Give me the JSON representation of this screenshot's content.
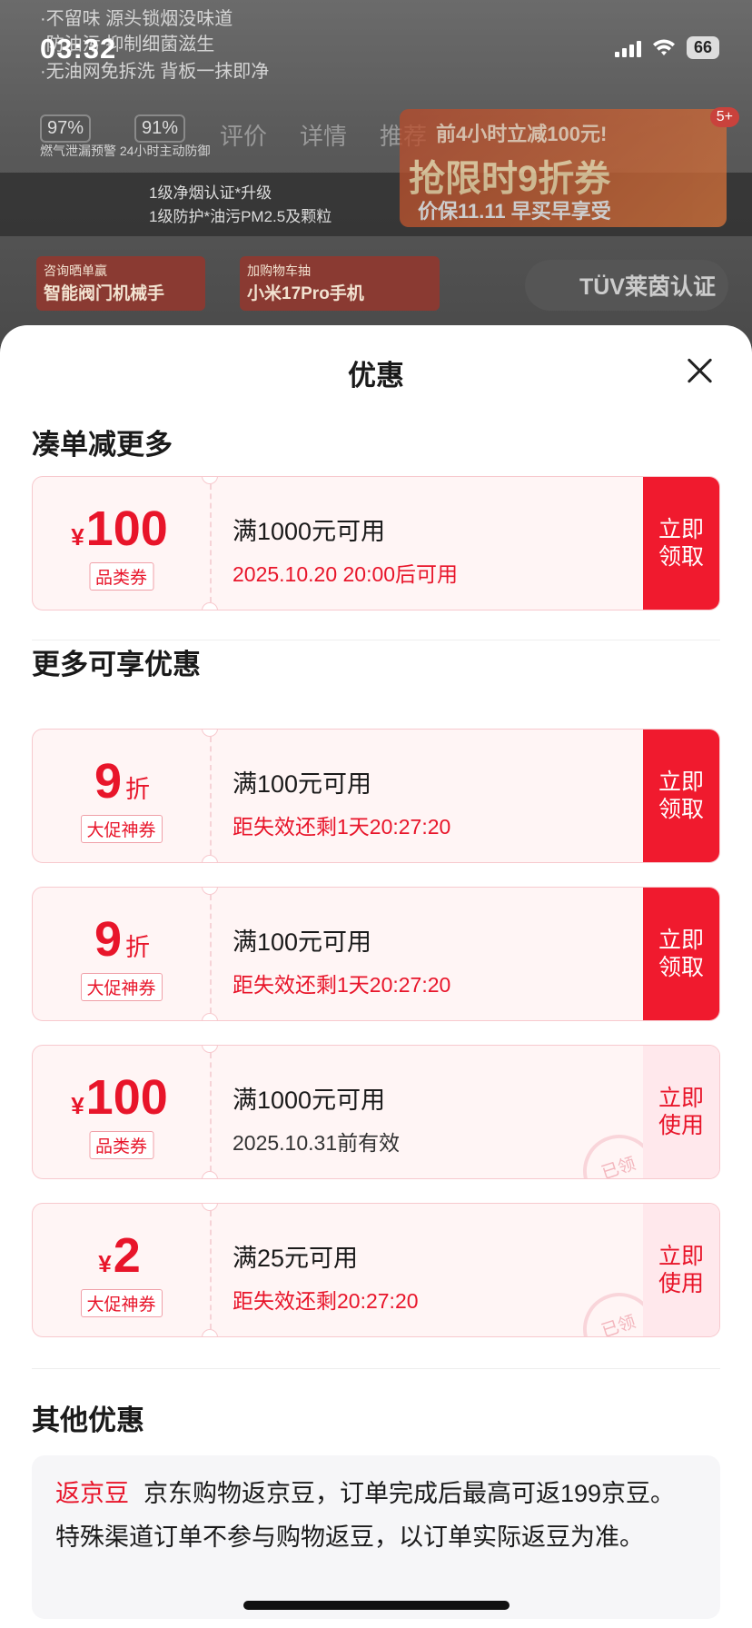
{
  "status_bar": {
    "time": "03:32",
    "battery": "66"
  },
  "background": {
    "lines": [
      "·不留味 源头锁烟没味道",
      "·防油污 抑制细菌滋生",
      "·无油网免拆洗 背板一抹即净"
    ],
    "badges": [
      "97%",
      "91%"
    ],
    "badge_caption": "燃气泄漏预警 24小时主动防御",
    "tabs": [
      "评价",
      "详情",
      "推荐"
    ],
    "promo_line1": "前4小时立减100元!",
    "promo_main": "抢限时9折券",
    "promo_line3": "价保11.11 早买早享受",
    "cert_line1": "1级净烟认证*升级",
    "cert_line2": "1级防护*油污PM2.5及颗粒",
    "card1": "智能阀门机械手",
    "card1_tag": "咨询晒单赢",
    "card2": "小米17Pro手机",
    "card2_tag": "加购物车抽",
    "tuv": "TÜV莱茵认证",
    "count_badge": "5+"
  },
  "sheet": {
    "title": "优惠",
    "section_more_discount": "凑单减更多",
    "section_more_offers": "更多可享优惠",
    "section_other": "其他优惠",
    "coupons": [
      {
        "currency": "¥",
        "amount": "100",
        "unit": "",
        "tag": "品类券",
        "condition": "满1000元可用",
        "sub": "2025.10.20 20:00后可用",
        "button": "立即领取"
      },
      {
        "currency": "",
        "amount": "9",
        "unit": "折",
        "tag": "大促神券",
        "condition": "满100元可用",
        "sub": "距失效还剩1天20:27:20",
        "button": "立即领取"
      },
      {
        "currency": "",
        "amount": "9",
        "unit": "折",
        "tag": "大促神券",
        "condition": "满100元可用",
        "sub": "距失效还剩1天20:27:20",
        "button": "立即领取"
      },
      {
        "currency": "¥",
        "amount": "100",
        "unit": "",
        "tag": "品类券",
        "condition": "满1000元可用",
        "sub": "2025.10.31前有效",
        "button": "立即使用",
        "stamp": "已领"
      },
      {
        "currency": "¥",
        "amount": "2",
        "unit": "",
        "tag": "大促神券",
        "condition": "满25元可用",
        "sub": "距失效还剩20:27:20",
        "button": "立即使用",
        "stamp": "已领"
      }
    ],
    "other_label": "返京豆",
    "other_text": "京东购物返京豆，订单完成后最高可返199京豆。特殊渠道订单不参与购物返豆，以订单实际返豆为准。"
  },
  "colors": {
    "accent": "#e8152a",
    "claim_bg": "#f01a2e",
    "coupon_bg": "#fff5f5"
  }
}
